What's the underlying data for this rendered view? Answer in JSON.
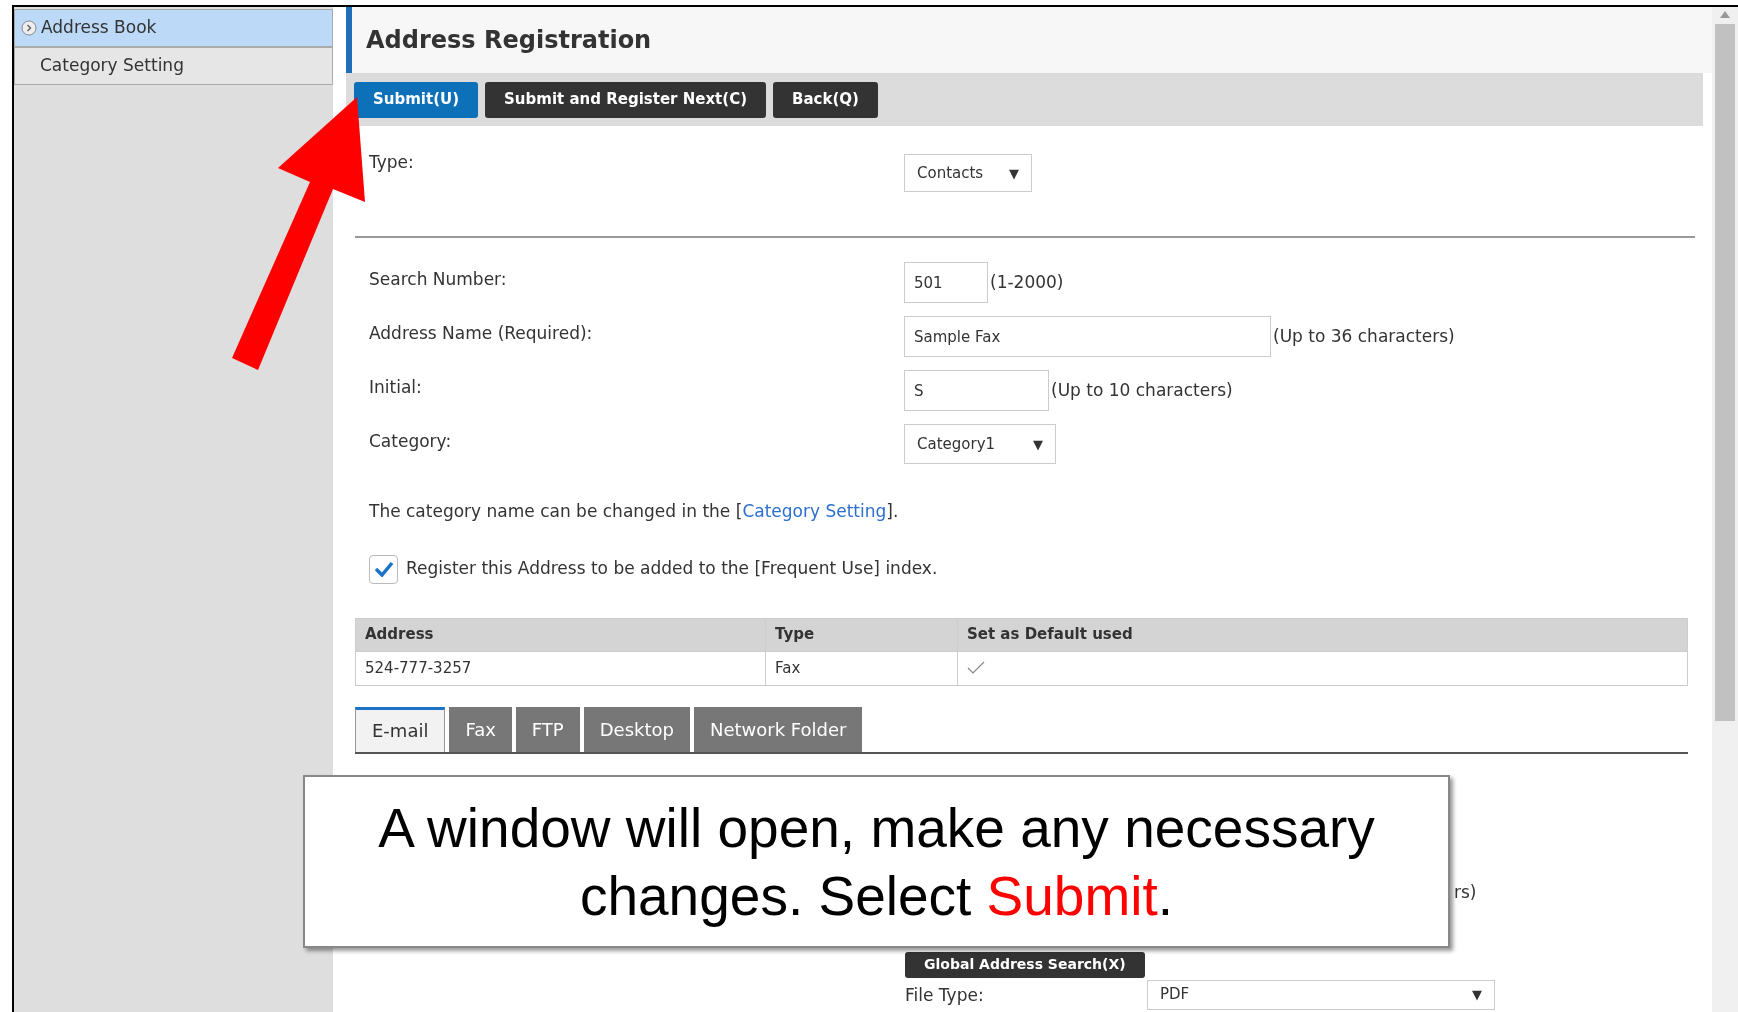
{
  "sidebar": {
    "items": [
      {
        "label": "Address Book",
        "selected": true
      },
      {
        "label": "Category Setting",
        "selected": false
      }
    ]
  },
  "page_title": "Address Registration",
  "toolbar": {
    "buttons": [
      {
        "label": "Submit(U)",
        "primary": true
      },
      {
        "label": "Submit and Register Next(C)",
        "primary": false
      },
      {
        "label": "Back(Q)",
        "primary": false
      }
    ]
  },
  "type_field": {
    "label": "Type:",
    "value": "Contacts",
    "caret": "▼"
  },
  "fields": [
    {
      "kind": "text",
      "label": "Search Number:",
      "value": "501",
      "hint": "(1-2000)"
    },
    {
      "kind": "text",
      "label": "Address Name (Required):",
      "value": "Sample Fax",
      "hint": "(Up to 36 characters)"
    },
    {
      "kind": "text",
      "label": "Initial:",
      "value": "S",
      "hint": "(Up to 10 characters)"
    },
    {
      "kind": "select",
      "label": "Category:",
      "value": "Category1",
      "caret": "▼"
    }
  ],
  "category_note": {
    "before": "The category name can be changed in the [",
    "link": "Category Setting",
    "after": "]."
  },
  "frequent_use": {
    "label": "Register this Address to be added to the [Frequent Use] index.",
    "checked": true
  },
  "table": {
    "columns": [
      "Address",
      "Type",
      "Set as Default used"
    ],
    "rows": [
      {
        "address": "524-777-3257",
        "type": "Fax",
        "default_used": true
      }
    ]
  },
  "tabs": [
    {
      "label": "E-mail",
      "selected": true
    },
    {
      "label": "Fax",
      "selected": false
    },
    {
      "label": "FTP",
      "selected": false
    },
    {
      "label": "Desktop",
      "selected": false
    },
    {
      "label": "Network Folder",
      "selected": false
    }
  ],
  "partial_hint": "rs)",
  "global_search_button": "Global Address Search(X)",
  "file_type": {
    "label": "File Type:",
    "value": "PDF",
    "caret": "▼"
  },
  "callout": {
    "before": "A window will open, make any necessary changes. Select ",
    "highlight": "Submit",
    "after": "."
  }
}
